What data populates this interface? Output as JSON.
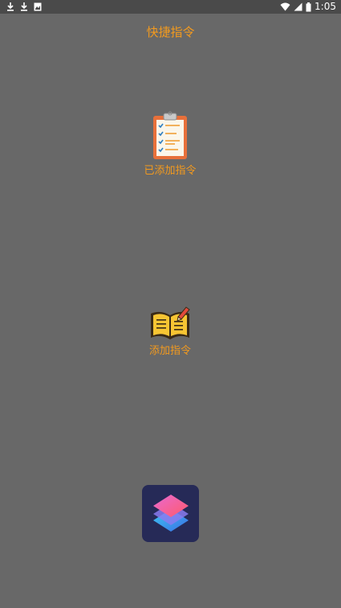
{
  "status_bar": {
    "left_icons": [
      "download-icon",
      "download-icon",
      "image-icon"
    ],
    "right_icons": [
      "wifi-icon",
      "signal-icon",
      "battery-icon"
    ],
    "time": "1:05"
  },
  "header": {
    "title": "快捷指令"
  },
  "menu": {
    "items": [
      {
        "icon": "clipboard-checklist-icon",
        "label": "已添加指令"
      },
      {
        "icon": "open-book-pencil-icon",
        "label": "添加指令"
      }
    ]
  },
  "app_icon": {
    "icon": "shortcuts-app-icon"
  },
  "colors": {
    "background": "#686868",
    "accent": "#f39a1e",
    "app_icon_bg": "#262a57"
  }
}
